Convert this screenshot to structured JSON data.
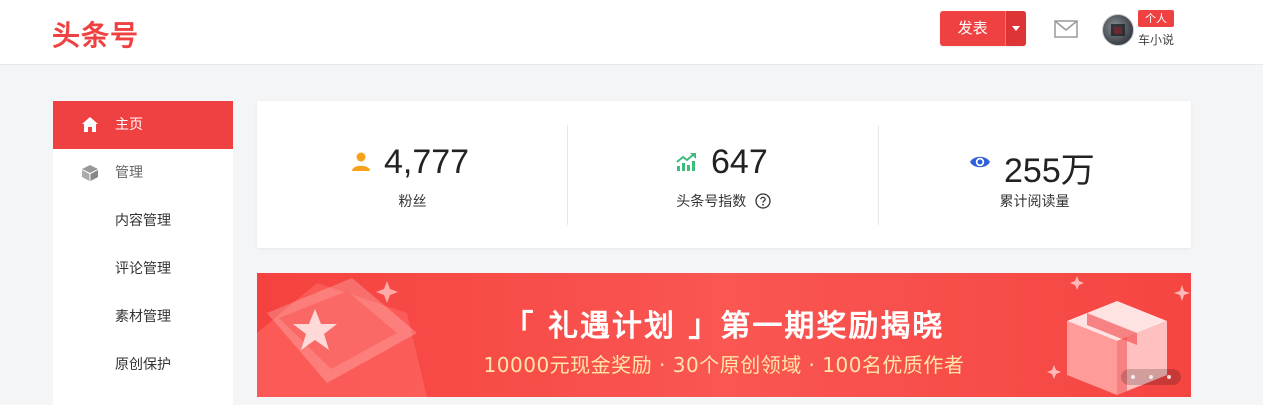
{
  "header": {
    "logo": "头条号",
    "publish_label": "发表",
    "badge": "个人",
    "username": "车小说"
  },
  "sidebar": {
    "items": [
      {
        "label": "主页",
        "icon": "home-icon"
      },
      {
        "label": "管理",
        "icon": "cube-icon"
      },
      {
        "label": "内容管理"
      },
      {
        "label": "评论管理"
      },
      {
        "label": "素材管理"
      },
      {
        "label": "原创保护"
      }
    ]
  },
  "stats": [
    {
      "value": "4,777",
      "label": "粉丝",
      "icon": "person-icon",
      "color": "#f7a21b"
    },
    {
      "value": "647",
      "label": "头条号指数",
      "icon": "trend-up-icon",
      "color": "#3dbd7d"
    },
    {
      "value": "255万",
      "label": "累计阅读量",
      "icon": "eye-icon",
      "color": "#2f5fd9"
    }
  ],
  "banner": {
    "title": "「 礼遇计划 」第一期奖励揭晓",
    "subtitle": "10000元现金奖励 · 30个原创领域 · 100名优质作者"
  },
  "colors": {
    "brand": "#f04142",
    "banner_subtitle": "#ffe6a8"
  }
}
